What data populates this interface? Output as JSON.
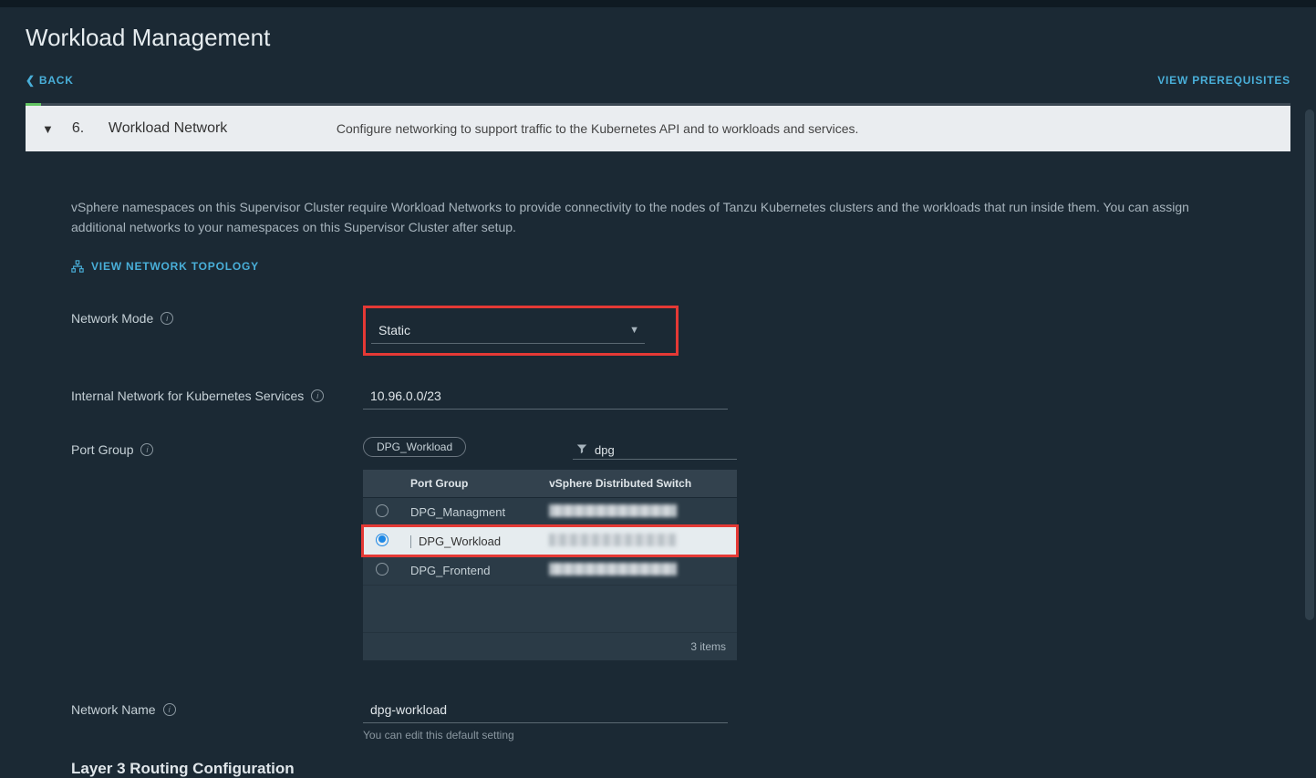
{
  "page_title": "Workload Management",
  "back_label": "BACK",
  "prereq_label": "VIEW PREREQUISITES",
  "step": {
    "number": "6.",
    "title": "Workload Network",
    "description": "Configure networking to support traffic to the Kubernetes API and to workloads and services."
  },
  "body_desc": "vSphere namespaces on this Supervisor Cluster require Workload Networks to provide connectivity to the nodes of Tanzu Kubernetes clusters and the workloads that run inside them. You can assign additional networks to your namespaces on this Supervisor Cluster after setup.",
  "view_topology_label": "VIEW NETWORK TOPOLOGY",
  "labels": {
    "network_mode": "Network Mode",
    "internal_network": "Internal Network for Kubernetes Services",
    "port_group": "Port Group",
    "network_name": "Network Name",
    "layer3": "Layer 3 Routing Configuration"
  },
  "network_mode_value": "Static",
  "internal_network_value": "10.96.0.0/23",
  "port_group": {
    "selected_chip": "DPG_Workload",
    "filter_value": "dpg",
    "columns": {
      "col1": "Port Group",
      "col2": "vSphere Distributed Switch"
    },
    "rows": [
      {
        "name": "DPG_Managment",
        "selected": false
      },
      {
        "name": "DPG_Workload",
        "selected": true
      },
      {
        "name": "DPG_Frontend",
        "selected": false
      }
    ],
    "footer": "3 items"
  },
  "network_name_value": "dpg-workload",
  "network_name_helper": "You can edit this default setting"
}
